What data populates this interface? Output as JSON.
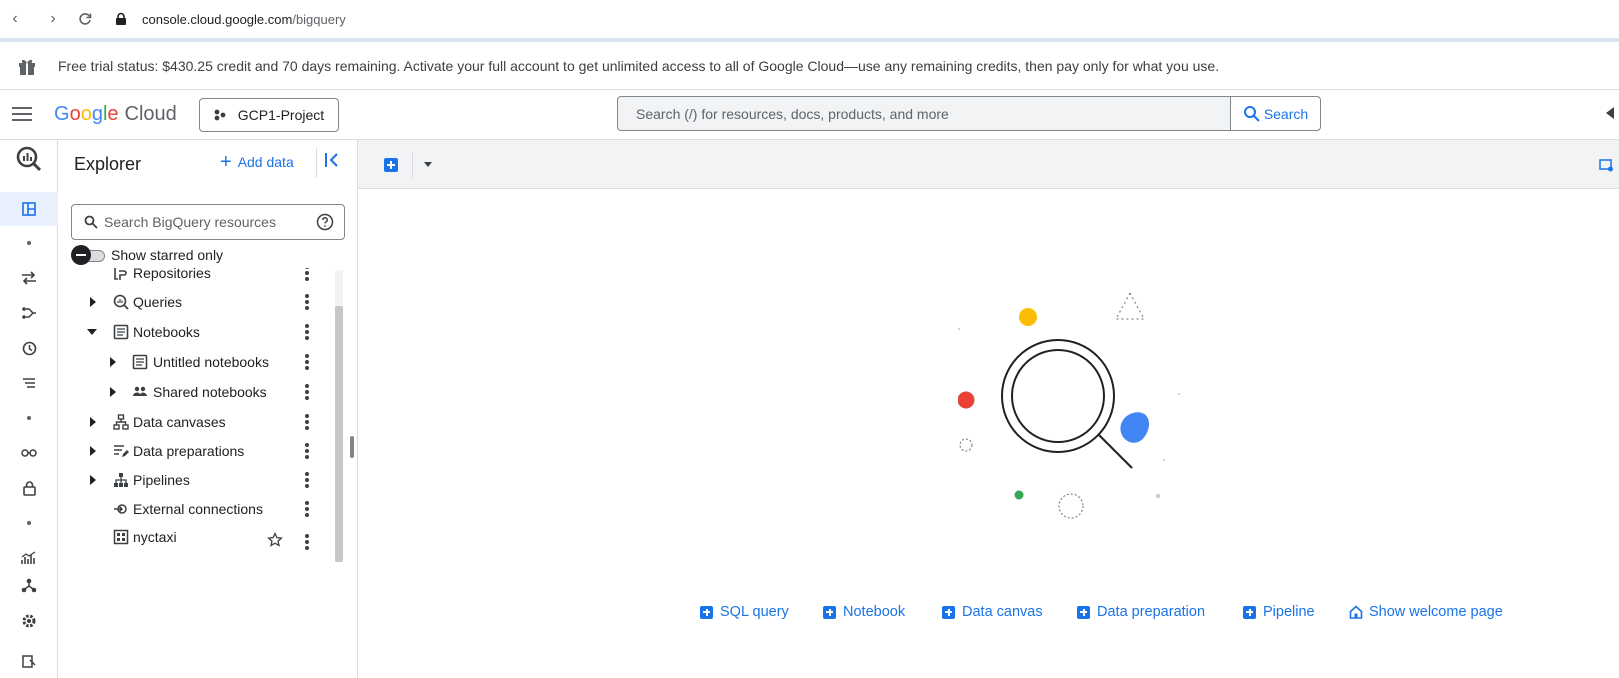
{
  "browser": {
    "url_host": "console.cloud.google.com",
    "url_path": "/bigquery"
  },
  "trial": {
    "message": "Free trial status: $430.25 credit and 70 days remaining. Activate your full account to get unlimited access to all of Google Cloud—use any remaining credits, then pay only for what you use."
  },
  "header": {
    "logo_google": "Google",
    "logo_cloud": "Cloud",
    "project": "GCP1-Project",
    "search_placeholder": "Search (/) for resources, docs, products, and more",
    "search_button": "Search"
  },
  "explorer": {
    "title": "Explorer",
    "add_data": "Add data",
    "search_placeholder": "Search BigQuery resources",
    "starred_toggle": "Show starred only",
    "tree": [
      {
        "label": "Repositories",
        "icon": "repository-icon",
        "expanded": null
      },
      {
        "label": "Queries",
        "icon": "query-icon",
        "expanded": false
      },
      {
        "label": "Notebooks",
        "icon": "notebook-icon",
        "expanded": true
      },
      {
        "label": "Untitled notebooks",
        "icon": "notebook-icon",
        "expanded": false
      },
      {
        "label": "Shared notebooks",
        "icon": "people-icon",
        "expanded": false
      },
      {
        "label": "Data canvases",
        "icon": "canvas-icon",
        "expanded": false
      },
      {
        "label": "Data preparations",
        "icon": "data-prep-icon",
        "expanded": false
      },
      {
        "label": "Pipelines",
        "icon": "pipeline-icon",
        "expanded": false
      },
      {
        "label": "External connections",
        "icon": "connection-icon",
        "expanded": null
      },
      {
        "label": "nyctaxi",
        "icon": "dataset-icon",
        "expanded": null
      }
    ]
  },
  "main": {
    "actions": [
      {
        "label": "SQL query",
        "icon": "plus-icon"
      },
      {
        "label": "Notebook",
        "icon": "plus-icon"
      },
      {
        "label": "Data canvas",
        "icon": "plus-icon"
      },
      {
        "label": "Data preparation",
        "icon": "plus-icon"
      },
      {
        "label": "Pipeline",
        "icon": "plus-icon"
      },
      {
        "label": "Show welcome page",
        "icon": "home-icon"
      }
    ]
  },
  "colors": {
    "accent": "#1a73e8",
    "google_blue": "#4285f4",
    "google_red": "#ea4335",
    "google_yellow": "#fbbc04",
    "google_green": "#34a853"
  }
}
